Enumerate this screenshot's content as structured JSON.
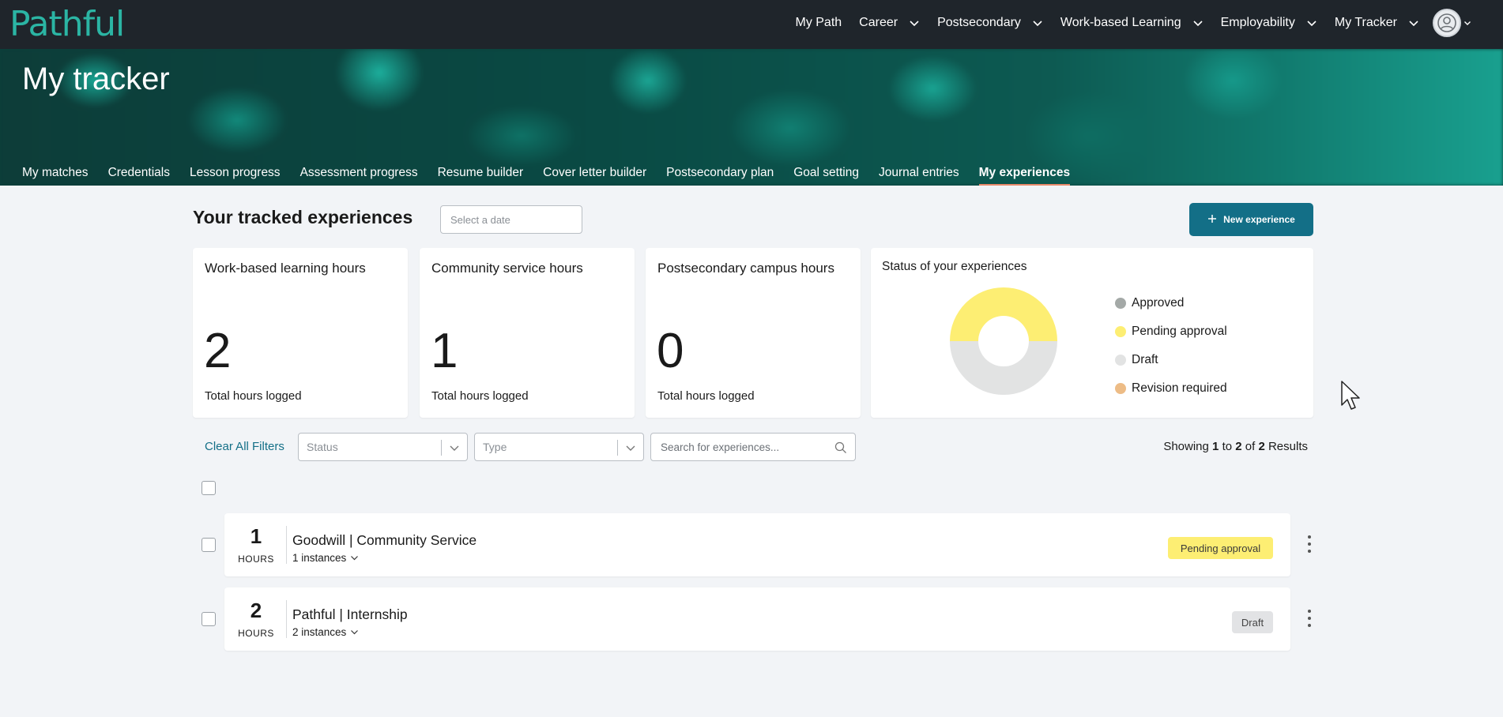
{
  "topbar": {
    "logo_text": "Pathful",
    "nav": [
      {
        "label": "My Path",
        "has_dropdown": false
      },
      {
        "label": "Career",
        "has_dropdown": true
      },
      {
        "label": "Postsecondary",
        "has_dropdown": true
      },
      {
        "label": "Work-based Learning",
        "has_dropdown": true
      },
      {
        "label": "Employability",
        "has_dropdown": true
      },
      {
        "label": "My Tracker",
        "has_dropdown": true
      }
    ]
  },
  "banner": {
    "title": "My tracker",
    "tabs": [
      "My matches",
      "Credentials",
      "Lesson progress",
      "Assessment progress",
      "Resume builder",
      "Cover letter builder",
      "Postsecondary plan",
      "Goal setting",
      "Journal entries",
      "My experiences"
    ],
    "active_tab": "My experiences"
  },
  "header": {
    "title": "Your tracked experiences",
    "date_placeholder": "Select a date",
    "new_button": "New experience"
  },
  "cards": [
    {
      "title": "Work-based learning hours",
      "value": "2",
      "sub": "Total hours logged"
    },
    {
      "title": "Community service hours",
      "value": "1",
      "sub": "Total hours logged"
    },
    {
      "title": "Postsecondary campus hours",
      "value": "0",
      "sub": "Total hours logged"
    }
  ],
  "status_card": {
    "title": "Status of your experiences",
    "legend": [
      {
        "label": "Approved",
        "color": "#a4a9a7",
        "count": 0
      },
      {
        "label": "Pending approval",
        "color": "#fdee73",
        "count": 1
      },
      {
        "label": "Draft",
        "color": "#e2e3e3",
        "count": 1
      },
      {
        "label": "Revision required",
        "color": "#edbc86",
        "count": 0
      }
    ]
  },
  "filters": {
    "clear_label": "Clear All Filters",
    "status_placeholder": "Status",
    "type_placeholder": "Type",
    "search_placeholder": "Search for experiences...",
    "results_prefix": "Showing",
    "results_from": "1",
    "results_to_word": "to",
    "results_to": "2",
    "results_of_word": "of",
    "results_total": "2",
    "results_suffix": "Results"
  },
  "experiences": [
    {
      "hours": "1",
      "unit": "HOURS",
      "title": "Goodwill | Community Service",
      "instances": "1 instances",
      "status": "Pending approval"
    },
    {
      "hours": "2",
      "unit": "HOURS",
      "title": "Pathful | Internship",
      "instances": "2 instances",
      "status": "Draft"
    }
  ],
  "colors": {
    "topbar_bg": "#1f252b",
    "brand_teal": "#2bb5a4",
    "primary_button": "#136f87",
    "link": "#136f87",
    "active_tab_underline": "#e8896a"
  }
}
